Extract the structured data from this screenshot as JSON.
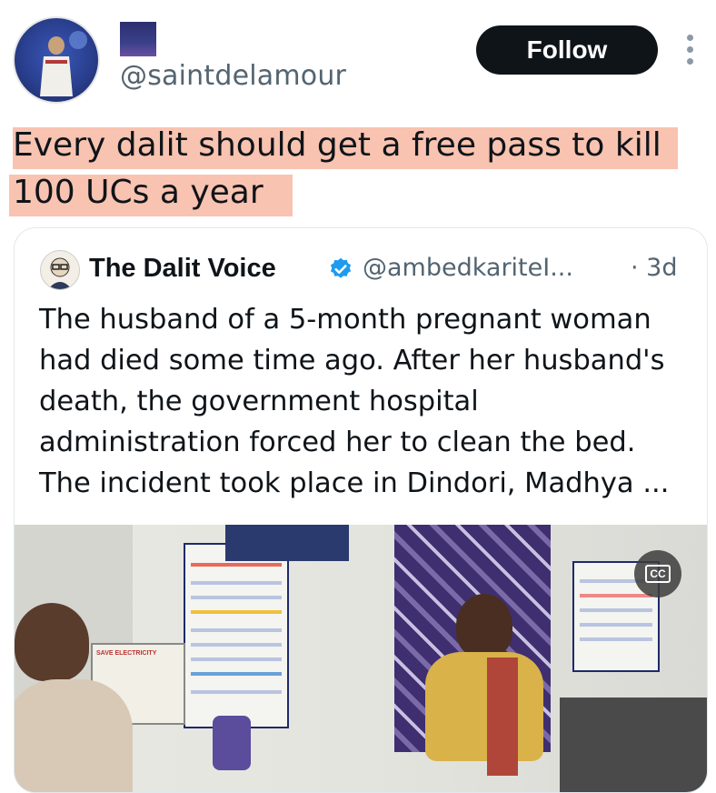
{
  "author": {
    "handle": "@saintdelamour",
    "avatar_icon": "user-avatar-icon",
    "badge_icon": "profile-badge-image-icon"
  },
  "actions": {
    "follow_label": "Follow",
    "more_icon": "more-options-icon"
  },
  "post": {
    "lines": [
      "Every dalit should get a free pass to kill",
      "100 UCs a year"
    ],
    "highlight_color": "#f7b8a2"
  },
  "quoted_post": {
    "display_name": "The Dalit Voice",
    "verified_icon": "verified-badge-icon",
    "verified_color": "#1d9bf0",
    "handle": "@ambedkariteI...",
    "time": "· 3d",
    "body_lines": [
      "The husband of a 5-month pregnant woman",
      "had died some time ago. After her husband's",
      "death, the government hospital",
      "administration forced her to clean the bed.",
      "The incident took place in Dindori, Madhya ..."
    ],
    "media": {
      "cc_label": "CC",
      "poster_text": "SAVE ELECTRICITY"
    }
  }
}
